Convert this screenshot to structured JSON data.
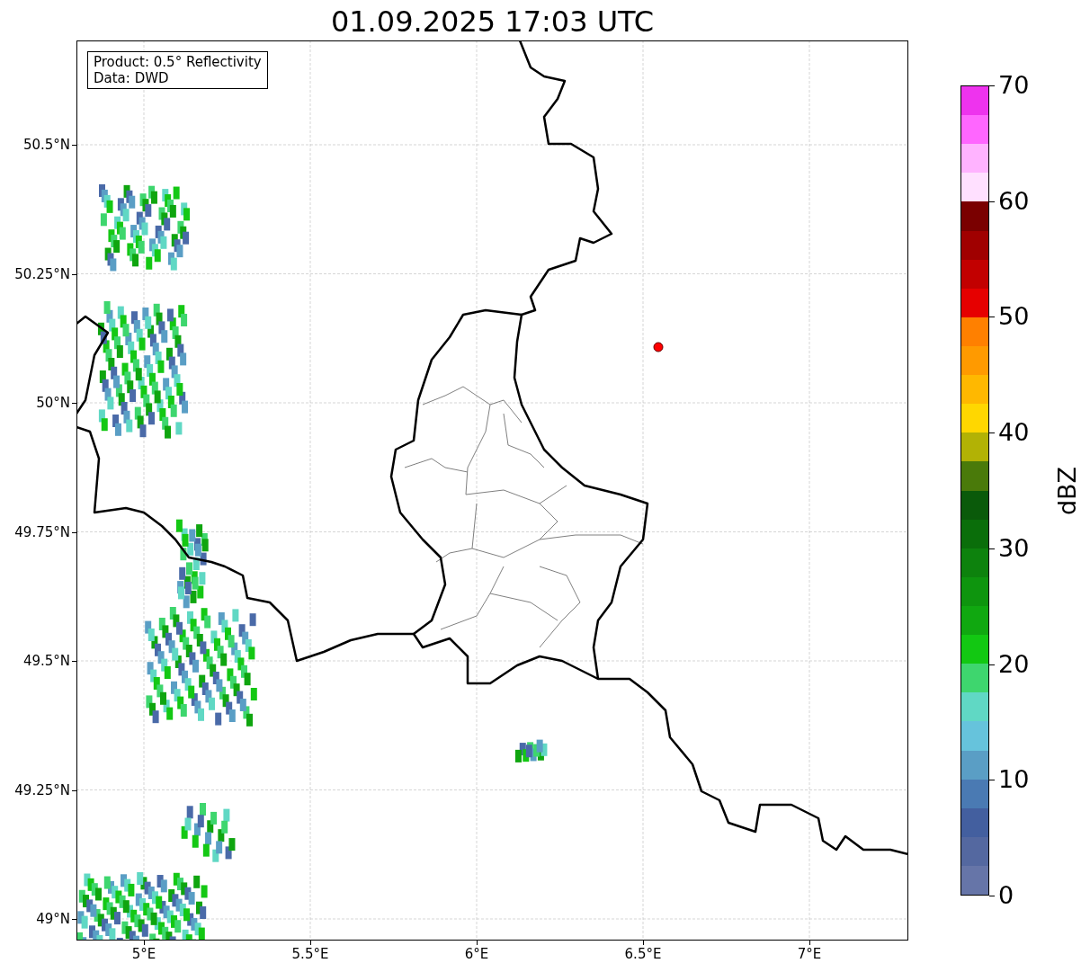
{
  "title": "01.09.2025 17:03 UTC",
  "info_box": {
    "lines": [
      "Product: 0.5° Reflectivity",
      "Data: DWD"
    ]
  },
  "axes": {
    "yticks": [
      "50.5°N",
      "50.25°N",
      "50°N",
      "49.75°N",
      "49.5°N",
      "49.25°N",
      "49°N"
    ],
    "xticks": [
      "5°E",
      "5.5°E",
      "6°E",
      "6.5°E",
      "7°E"
    ]
  },
  "colorbar": {
    "label": "dBZ",
    "ticks": [
      "70",
      "60",
      "50",
      "40",
      "30",
      "20",
      "10",
      "0"
    ],
    "segments": [
      {
        "color": "#ee33ee"
      },
      {
        "color": "#ff66ff"
      },
      {
        "color": "#ffb3ff"
      },
      {
        "color": "#ffe0ff"
      },
      {
        "color": "#7a0000"
      },
      {
        "color": "#a00000"
      },
      {
        "color": "#c20000"
      },
      {
        "color": "#e60000"
      },
      {
        "color": "#ff8000"
      },
      {
        "color": "#ff9a00"
      },
      {
        "color": "#ffb800"
      },
      {
        "color": "#ffd700"
      },
      {
        "color": "#b2b205"
      },
      {
        "color": "#4a7a0a"
      },
      {
        "color": "#0a5a0a"
      },
      {
        "color": "#0a6e0a"
      },
      {
        "color": "#0d820d"
      },
      {
        "color": "#0e950e"
      },
      {
        "color": "#10a810"
      },
      {
        "color": "#12c812"
      },
      {
        "color": "#3ed66e"
      },
      {
        "color": "#60d8c4"
      },
      {
        "color": "#66c3dc"
      },
      {
        "color": "#5a9ec5"
      },
      {
        "color": "#4a7ab3"
      },
      {
        "color": "#435f9f"
      },
      {
        "color": "#5468a0"
      },
      {
        "color": "#6675a8"
      }
    ]
  }
}
